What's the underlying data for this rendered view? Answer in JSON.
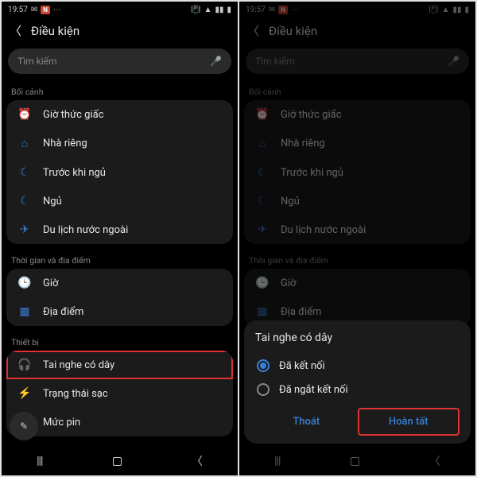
{
  "statusbar": {
    "time": "19:57",
    "badge": "N"
  },
  "header": {
    "title": "Điều kiện"
  },
  "search": {
    "placeholder": "Tìm kiếm"
  },
  "section": {
    "context": "Bối cảnh",
    "timeplace": "Thời gian và địa điểm",
    "device": "Thiết bị"
  },
  "rows": {
    "alarm": "Giờ thức giấc",
    "home": "Nhà riêng",
    "presleep": "Trước khi ngủ",
    "sleep": "Ngủ",
    "travel": "Du lịch nước ngoài",
    "time": "Giờ",
    "place": "Địa điểm",
    "headphones": "Tai nghe có dây",
    "charging": "Trạng thái sạc",
    "battery": "Mức pin"
  },
  "sheet": {
    "title": "Tai nghe có dây",
    "opt_connected": "Đã kết nối",
    "opt_disconnected": "Đã ngắt kết nối",
    "cancel": "Thoát",
    "done": "Hoàn tất"
  }
}
